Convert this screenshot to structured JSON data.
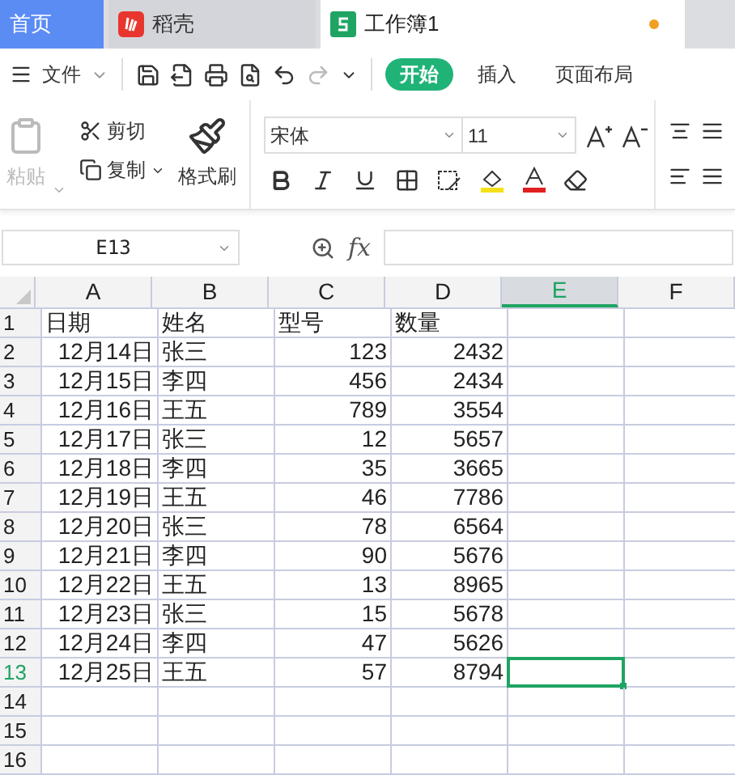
{
  "tabs": [
    {
      "label": "首页",
      "kind": "home",
      "selected": false
    },
    {
      "label": "稻壳",
      "kind": "docer",
      "selected": false
    },
    {
      "label": "工作簿1",
      "kind": "sheet",
      "selected": true,
      "unsaved": true
    }
  ],
  "menu": {
    "file": "文件",
    "tabs": [
      {
        "label": "开始",
        "selected": true
      },
      {
        "label": "插入",
        "selected": false
      },
      {
        "label": "页面布局",
        "selected": false
      }
    ]
  },
  "ribbon": {
    "paste": {
      "label": "粘贴",
      "disabled": true
    },
    "cut": "剪切",
    "copy": "复制",
    "format_painter": "格式刷",
    "font": "宋体",
    "size": "11"
  },
  "name_box": "E13",
  "formula_label": "fx",
  "columns": [
    {
      "label": "A",
      "selected": false
    },
    {
      "label": "B",
      "selected": false
    },
    {
      "label": "C",
      "selected": false
    },
    {
      "label": "D",
      "selected": false
    },
    {
      "label": "E",
      "selected": true
    },
    {
      "label": "F",
      "selected": false
    }
  ],
  "rows": [
    {
      "number": "1",
      "kind": "header",
      "selected": false,
      "cells": [
        "日期",
        "姓名",
        "型号",
        "数量"
      ]
    },
    {
      "number": "2",
      "kind": "data",
      "selected": false,
      "cells": [
        "12月14日",
        "张三",
        "123",
        "2432"
      ]
    },
    {
      "number": "3",
      "kind": "data",
      "selected": false,
      "cells": [
        "12月15日",
        "李四",
        "456",
        "2434"
      ]
    },
    {
      "number": "4",
      "kind": "data",
      "selected": false,
      "cells": [
        "12月16日",
        "王五",
        "789",
        "3554"
      ]
    },
    {
      "number": "5",
      "kind": "data",
      "selected": false,
      "cells": [
        "12月17日",
        "张三",
        "12",
        "5657"
      ]
    },
    {
      "number": "6",
      "kind": "data",
      "selected": false,
      "cells": [
        "12月18日",
        "李四",
        "35",
        "3665"
      ]
    },
    {
      "number": "7",
      "kind": "data",
      "selected": false,
      "cells": [
        "12月19日",
        "王五",
        "46",
        "7786"
      ]
    },
    {
      "number": "8",
      "kind": "data",
      "selected": false,
      "cells": [
        "12月20日",
        "张三",
        "78",
        "6564"
      ]
    },
    {
      "number": "9",
      "kind": "data",
      "selected": false,
      "cells": [
        "12月21日",
        "李四",
        "90",
        "5676"
      ]
    },
    {
      "number": "10",
      "kind": "data",
      "selected": false,
      "cells": [
        "12月22日",
        "王五",
        "13",
        "8965"
      ]
    },
    {
      "number": "11",
      "kind": "data",
      "selected": false,
      "cells": [
        "12月23日",
        "张三",
        "15",
        "5678"
      ]
    },
    {
      "number": "12",
      "kind": "data",
      "selected": false,
      "cells": [
        "12月24日",
        "李四",
        "47",
        "5626"
      ]
    },
    {
      "number": "13",
      "kind": "data",
      "selected": true,
      "cells": [
        "12月25日",
        "王五",
        "57",
        "8794"
      ]
    },
    {
      "number": "14",
      "kind": "data",
      "selected": false,
      "cells": []
    },
    {
      "number": "15",
      "kind": "data",
      "selected": false,
      "cells": []
    },
    {
      "number": "16",
      "kind": "data",
      "selected": false,
      "cells": []
    }
  ]
}
